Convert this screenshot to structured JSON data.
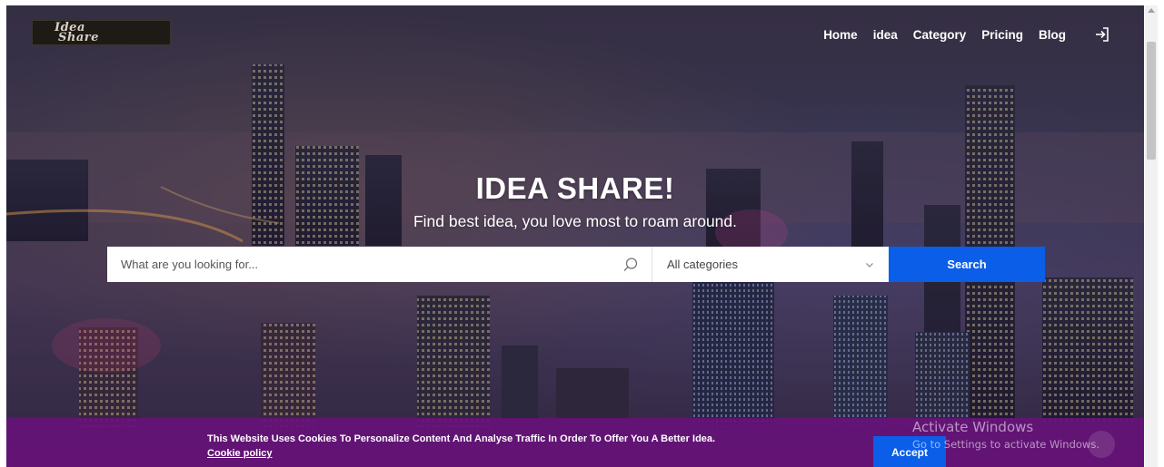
{
  "header": {
    "logo_line1": "Idea",
    "logo_line2": "Share",
    "nav": [
      "Home",
      "idea",
      "Category",
      "Pricing",
      "Blog"
    ],
    "login_icon": "sign-in-icon"
  },
  "hero": {
    "title": "IDEA SHARE!",
    "subtitle": "Find best idea, you love most to roam around."
  },
  "search": {
    "placeholder": "What are you looking for...",
    "value": "",
    "category_selected": "All categories",
    "button_label": "Search",
    "search_icon": "magnifier-icon",
    "dropdown_icon": "chevron-down-icon"
  },
  "cookie": {
    "message": "This Website Uses Cookies To Personalize Content And Analyse Traffic In Order To Offer You A Better Idea.",
    "policy_link": "Cookie policy",
    "accept_label": "Accept"
  },
  "watermark": {
    "line1": "Activate Windows",
    "line2": "Go to Settings to activate Windows."
  },
  "colors": {
    "accent": "#0a5ee8",
    "cookie_bar": "#661278"
  }
}
